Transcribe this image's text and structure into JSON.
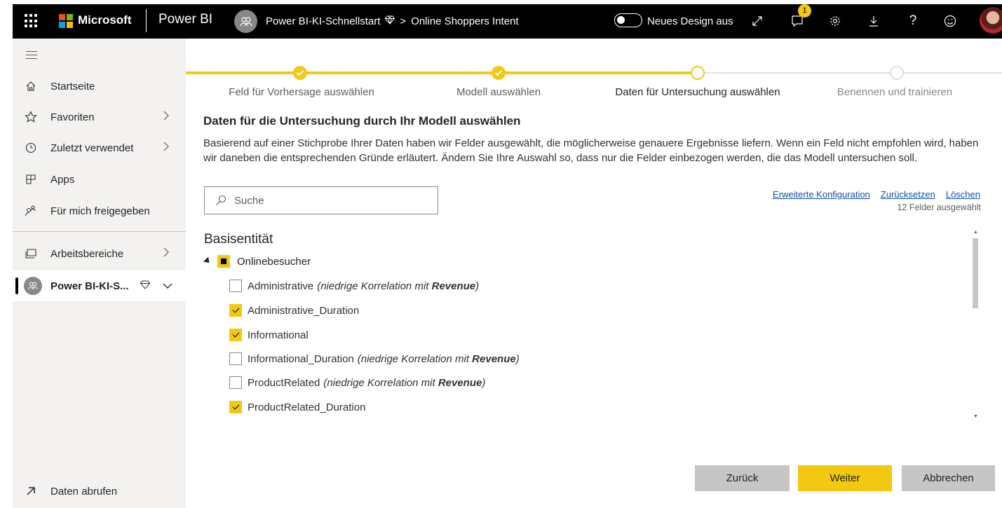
{
  "topbar": {
    "brand": "Microsoft",
    "product": "Power BI",
    "breadcrumb_workspace": "Power BI-KI-Schnellstart",
    "breadcrumb_separator": ">",
    "breadcrumb_item": "Online Shoppers Intent",
    "design_toggle_label": "Neues Design aus",
    "notification_count": "1",
    "help_glyph": "?"
  },
  "sidebar": {
    "items": [
      {
        "label": "Startseite",
        "icon": "home-icon"
      },
      {
        "label": "Favoriten",
        "icon": "star-icon"
      },
      {
        "label": "Zuletzt verwendet",
        "icon": "clock-icon"
      },
      {
        "label": "Apps",
        "icon": "apps-icon"
      },
      {
        "label": "Für mich freigegeben",
        "icon": "shared-icon"
      },
      {
        "label": "Arbeitsbereiche",
        "icon": "workspaces-icon"
      },
      {
        "label": "Power BI-KI-S...",
        "icon": "workspace-avatar-icon"
      }
    ],
    "footer_label": "Daten abrufen"
  },
  "wizard": {
    "steps": [
      {
        "label": "Feld für Vorhersage auswählen",
        "state": "done"
      },
      {
        "label": "Modell auswählen",
        "state": "done"
      },
      {
        "label": "Daten für Untersuchung auswählen",
        "state": "current"
      },
      {
        "label": "Benennen und trainieren",
        "state": "pending"
      }
    ],
    "accent_color": "#F2C811"
  },
  "main": {
    "title": "Daten für die Untersuchung durch Ihr Modell auswählen",
    "description": "Basierend auf einer Stichprobe Ihrer Daten haben wir Felder ausgewählt, die möglicherweise genauere Ergebnisse liefern. Wenn ein Feld nicht empfohlen wird, haben wir daneben die entsprechenden Gründe erläutert. Ändern Sie Ihre Auswahl so, dass nur die Felder einbezogen werden, die das Modell untersuchen soll.",
    "search_placeholder": "Suche",
    "link_advanced": "Erweiterte Konfiguration",
    "link_reset": "Zurücksetzen",
    "link_delete": "Löschen",
    "selected_count": "12 Felder ausgewählt",
    "entity_heading": "Basisentität",
    "entity_name": "Onlinebesucher",
    "fields": [
      {
        "name": "Administrative",
        "checked": false,
        "note_prefix": "(niedrige Korrelation mit ",
        "note_bold": "Revenue",
        "note_suffix": ")"
      },
      {
        "name": "Administrative_Duration",
        "checked": true
      },
      {
        "name": "Informational",
        "checked": true
      },
      {
        "name": "Informational_Duration",
        "checked": false,
        "note_prefix": "(niedrige Korrelation mit ",
        "note_bold": "Revenue",
        "note_suffix": ")"
      },
      {
        "name": "ProductRelated",
        "checked": false,
        "note_prefix": "(niedrige Korrelation mit ",
        "note_bold": "Revenue",
        "note_suffix": ")"
      },
      {
        "name": "ProductRelated_Duration",
        "checked": true
      }
    ]
  },
  "buttons": {
    "back": "Zurück",
    "next": "Weiter",
    "cancel": "Abbrechen"
  }
}
